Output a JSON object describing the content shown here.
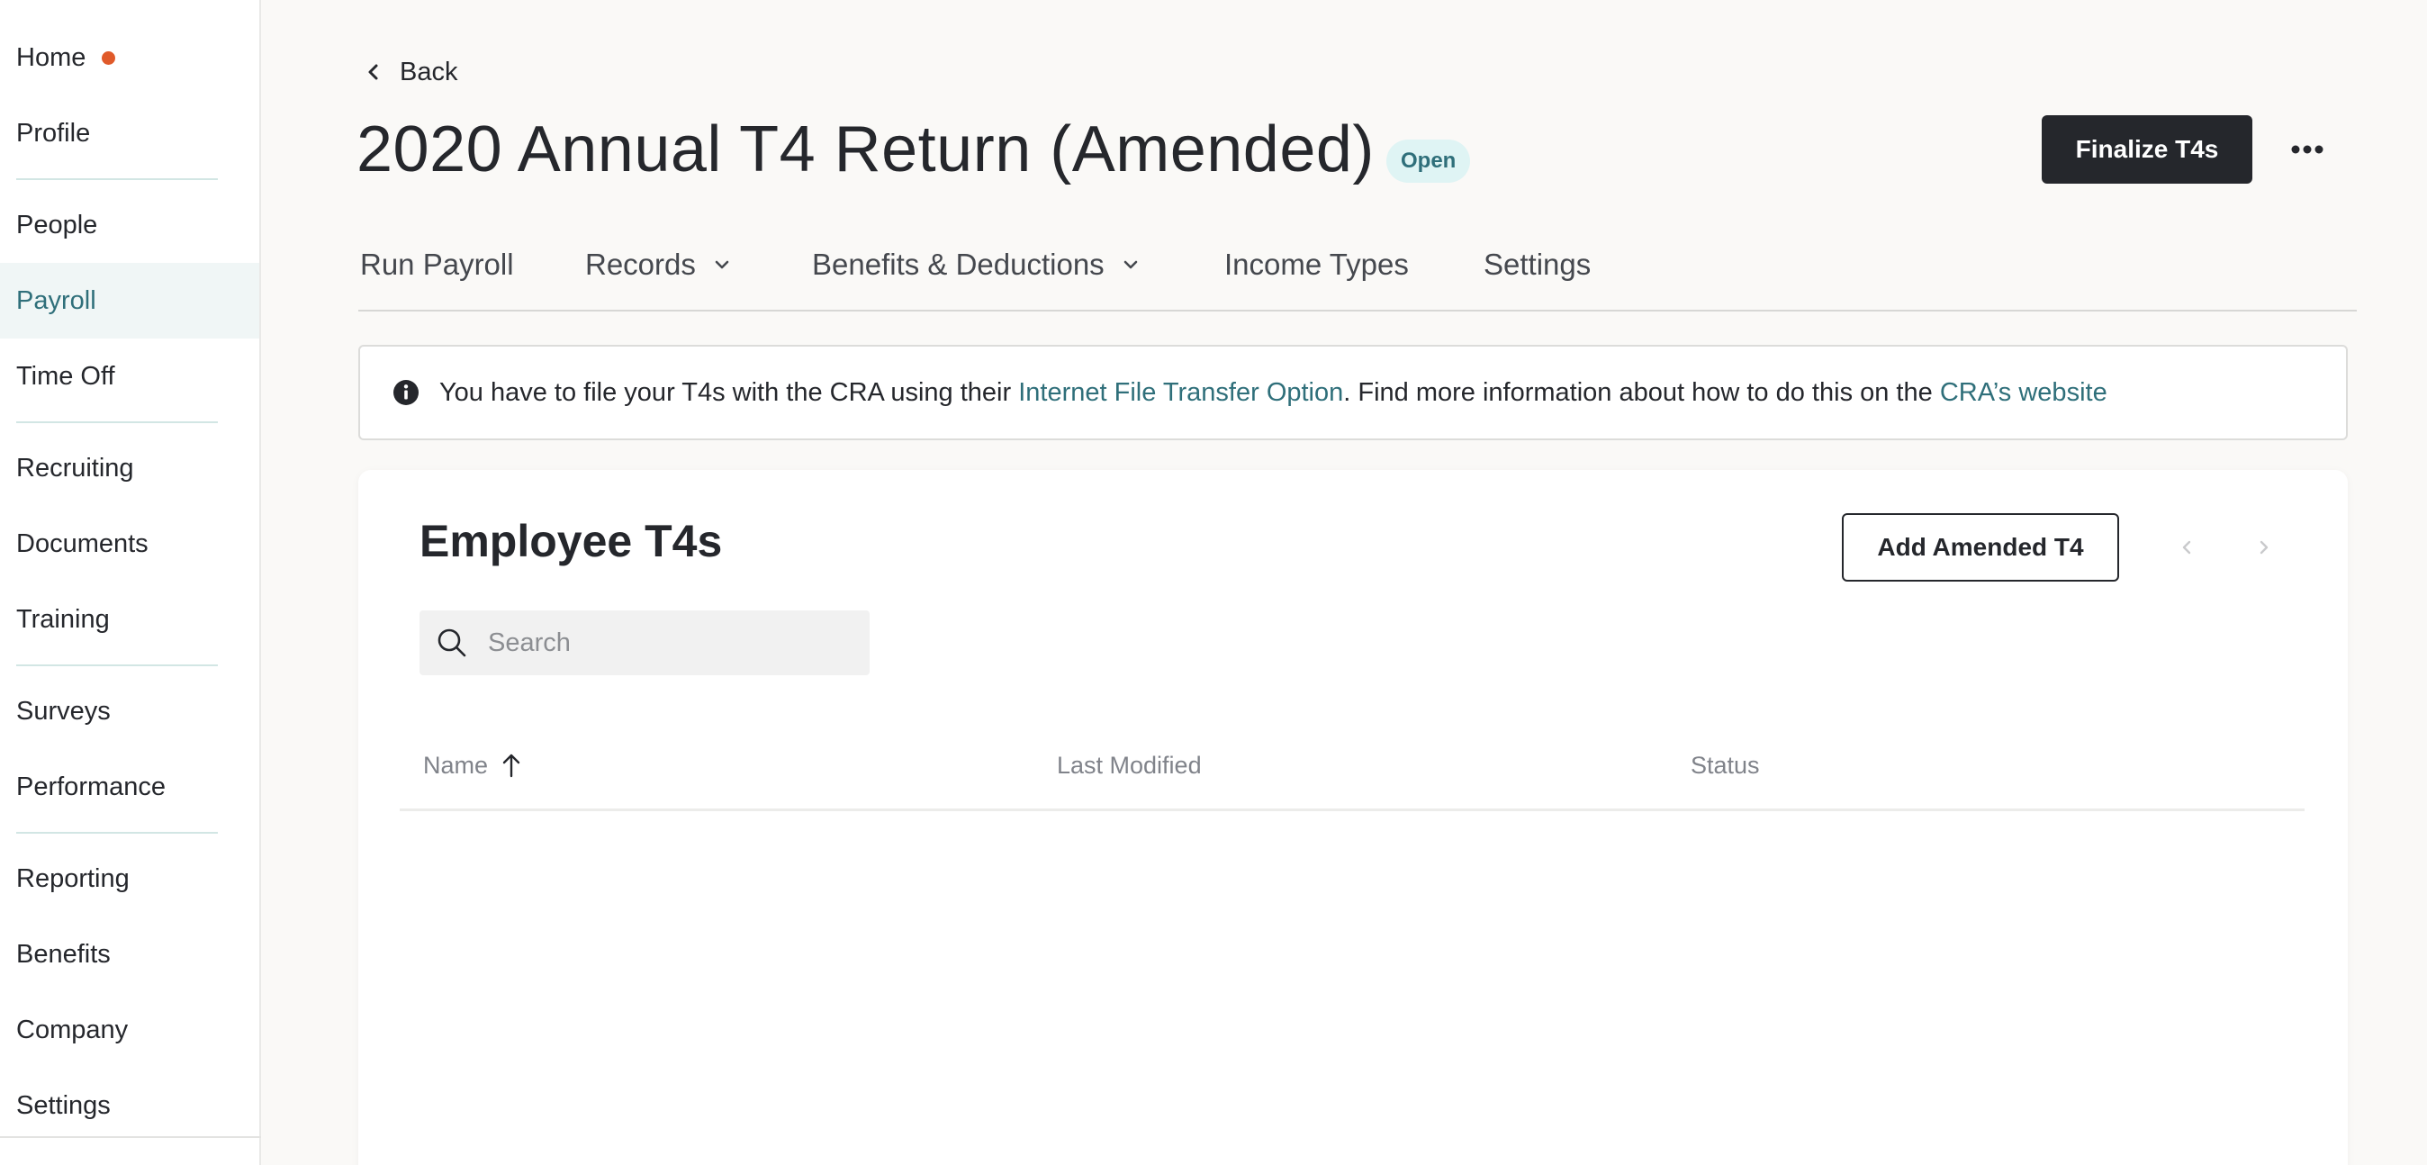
{
  "sidebar": {
    "items": [
      {
        "label": "Home",
        "badge_dot": true
      },
      {
        "label": "Profile"
      },
      {
        "label": "People"
      },
      {
        "label": "Payroll",
        "active": true
      },
      {
        "label": "Time Off"
      },
      {
        "label": "Recruiting"
      },
      {
        "label": "Documents"
      },
      {
        "label": "Training"
      },
      {
        "label": "Surveys"
      },
      {
        "label": "Performance"
      },
      {
        "label": "Reporting"
      },
      {
        "label": "Benefits"
      },
      {
        "label": "Company"
      },
      {
        "label": "Settings"
      }
    ]
  },
  "header": {
    "back_label": "Back",
    "title": "2020 Annual T4 Return (Amended)",
    "status_badge": "Open",
    "finalize_label": "Finalize T4s"
  },
  "tabs": [
    {
      "label": "Run Payroll"
    },
    {
      "label": "Records",
      "has_dropdown": true
    },
    {
      "label": "Benefits & Deductions",
      "has_dropdown": true
    },
    {
      "label": "Income Types"
    },
    {
      "label": "Settings"
    }
  ],
  "banner": {
    "text_before": "You have to file your T4s with the CRA using their",
    "link_1": "Internet File Transfer Option",
    "text_middle": ". Find more information about how to do this on the",
    "link_2": "CRA’s website"
  },
  "card": {
    "title": "Employee T4s",
    "add_button": "Add Amended T4",
    "search_placeholder": "Search",
    "columns": [
      "Name",
      "Last Modified",
      "Status"
    ],
    "rows": []
  },
  "colors": {
    "accent": "#2f6f7a",
    "dark": "#25272c",
    "notification_dot": "#e05a2a",
    "badge_bg": "#dff4f4"
  }
}
